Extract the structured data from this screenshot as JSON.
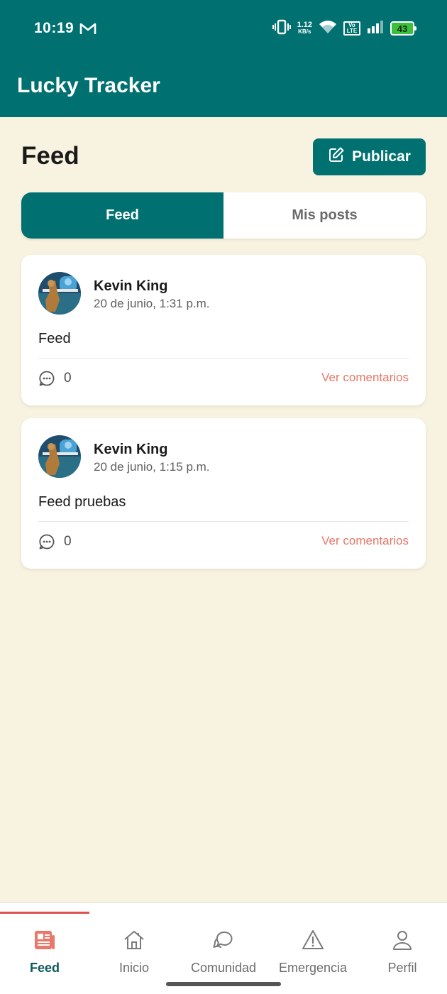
{
  "status_bar": {
    "time": "10:19",
    "net_speed": "1.12",
    "net_unit": "KB/s",
    "volte_top": "Vo",
    "volte_bottom": "LTE",
    "battery": "43"
  },
  "header": {
    "app_title": "Lucky Tracker"
  },
  "page": {
    "title": "Feed",
    "publish_label": "Publicar"
  },
  "tabs": [
    {
      "label": "Feed",
      "active": true
    },
    {
      "label": "Mis posts",
      "active": false
    }
  ],
  "posts": [
    {
      "author": "Kevin King",
      "timestamp": "20 de junio, 1:31 p.m.",
      "body": "Feed",
      "comment_count": "0",
      "view_comments_label": "Ver comentarios"
    },
    {
      "author": "Kevin King",
      "timestamp": "20 de junio, 1:15 p.m.",
      "body": "Feed pruebas",
      "comment_count": "0",
      "view_comments_label": "Ver comentarios"
    }
  ],
  "bottom_nav": [
    {
      "label": "Feed",
      "icon": "newspaper-icon",
      "active": true
    },
    {
      "label": "Inicio",
      "icon": "home-icon",
      "active": false
    },
    {
      "label": "Comunidad",
      "icon": "chat-bubbles-icon",
      "active": false
    },
    {
      "label": "Emergencia",
      "icon": "warning-icon",
      "active": false
    },
    {
      "label": "Perfil",
      "icon": "user-icon",
      "active": false
    }
  ],
  "colors": {
    "primary": "#007170",
    "background": "#F8F3E0",
    "accent": "#E57868",
    "indicator": "#E05050"
  }
}
